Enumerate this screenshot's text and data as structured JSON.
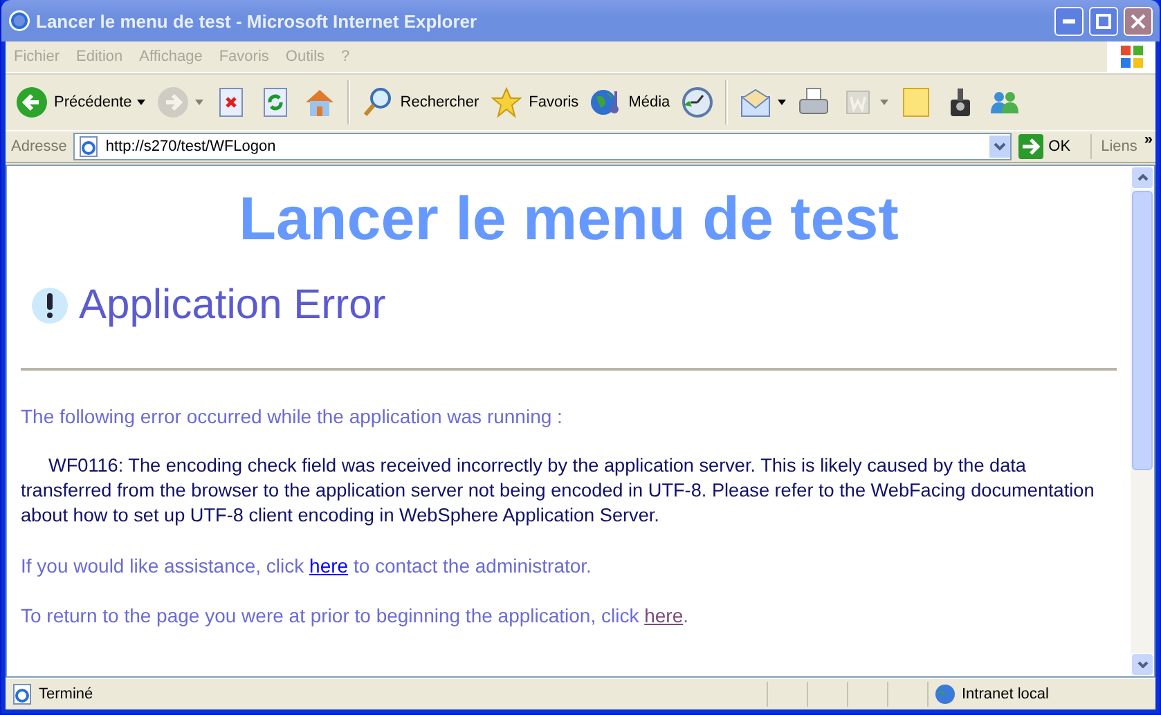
{
  "window": {
    "title": "Lancer le menu de test - Microsoft Internet Explorer"
  },
  "menu": [
    "Fichier",
    "Edition",
    "Affichage",
    "Favoris",
    "Outils",
    "?"
  ],
  "toolbar": [
    {
      "kind": "back",
      "label": "Précédente",
      "dropdown": true,
      "disabled": false
    },
    {
      "kind": "forward",
      "dropdown": true,
      "disabled": true
    },
    {
      "kind": "stop",
      "disabled": false
    },
    {
      "kind": "refresh",
      "disabled": false
    },
    {
      "kind": "home",
      "disabled": false
    },
    {
      "kind": "separator"
    },
    {
      "kind": "search",
      "label": "Rechercher",
      "disabled": false
    },
    {
      "kind": "star",
      "label": "Favoris",
      "disabled": false
    },
    {
      "kind": "globe",
      "label": "Média",
      "disabled": false
    },
    {
      "kind": "history",
      "disabled": false
    },
    {
      "kind": "separator"
    },
    {
      "kind": "mail",
      "dropdown": true,
      "disabled": false
    },
    {
      "kind": "print",
      "disabled": false
    },
    {
      "kind": "word",
      "dropdown": true,
      "disabled": true
    },
    {
      "kind": "note",
      "disabled": false
    },
    {
      "kind": "game",
      "disabled": false
    },
    {
      "kind": "people",
      "disabled": false
    }
  ],
  "address": {
    "label": "Adresse",
    "value": "http://s270/test/WFLogon",
    "go": "OK",
    "links": "Liens",
    "more": "»"
  },
  "page": {
    "heading": "Lancer le menu de test",
    "error_title": "Application Error",
    "intro": "The following error occurred while the application was running :",
    "message": "WF0116: The encoding check field was received incorrectly by the application server. This is likely caused by the data transferred from the browser to the application server not being encoded in UTF-8. Please refer to the WebFacing documentation about how to set up UTF-8 client encoding in WebSphere Application Server.",
    "paragraphs": [
      {
        "before": "If you would like assistance, click ",
        "link": "here",
        "visited": false,
        "after": " to contact the administrator."
      },
      {
        "before": "To return to the page you were at prior to beginning the application, click ",
        "link": "here",
        "visited": true,
        "after": "."
      }
    ]
  },
  "status_bar": {
    "text": "Terminé",
    "zone": "Intranet local"
  }
}
